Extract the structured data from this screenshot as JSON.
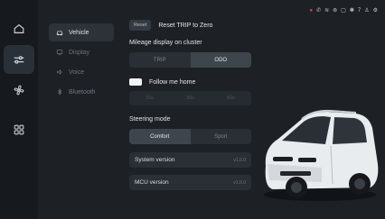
{
  "rail": {
    "items": [
      "home-icon",
      "vehicle-settings-icon",
      "fan-icon",
      "apps-icon"
    ]
  },
  "submenu": {
    "items": [
      {
        "label": "Vehicle",
        "icon": "car-icon"
      },
      {
        "label": "Display",
        "icon": "display-icon"
      },
      {
        "label": "Voice",
        "icon": "voice-icon"
      },
      {
        "label": "Bluetooth",
        "icon": "bluetooth-icon"
      }
    ]
  },
  "status": {
    "temp": "7"
  },
  "panel": {
    "reset_button": "Reset",
    "reset_title": "Reset TRIP to Zero",
    "mileage_label": "Mileage display on cluster",
    "mileage_options": [
      "TRIP",
      "ODO"
    ],
    "follow_label": "Follow me home",
    "follow_options": [
      "15s",
      "30s",
      "60s"
    ],
    "steering_label": "Steering mode",
    "steering_options": [
      "Comfort",
      "Sport"
    ],
    "system_version_label": "System version",
    "system_version_value": "v1.0.0",
    "mcu_version_label": "MCU version",
    "mcu_version_value": "v1.0.0"
  },
  "colors": {
    "accent_red": "#e5473a",
    "bg": "#1d2126"
  }
}
